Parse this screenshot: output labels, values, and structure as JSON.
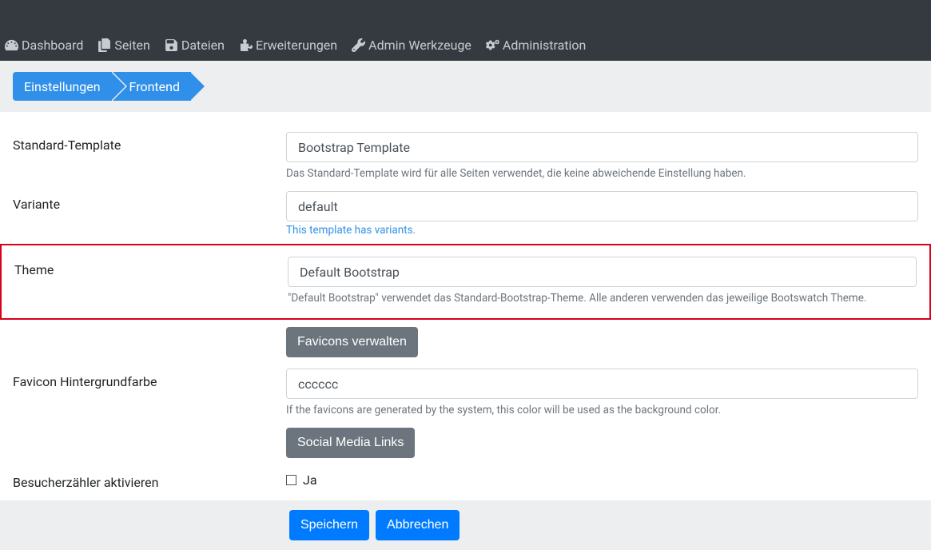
{
  "nav": {
    "dashboard": "Dashboard",
    "seiten": "Seiten",
    "dateien": "Dateien",
    "erweiterungen": "Erweiterungen",
    "admin_tools": "Admin Werkzeuge",
    "administration": "Administration"
  },
  "breadcrumb": {
    "a": "Einstellungen",
    "b": "Frontend"
  },
  "form": {
    "standard_template": {
      "label": "Standard-Template",
      "value": "Bootstrap Template",
      "help": "Das Standard-Template wird für alle Seiten verwendet, die keine abweichende Einstellung haben."
    },
    "variante": {
      "label": "Variante",
      "value": "default",
      "help": "This template has variants."
    },
    "theme": {
      "label": "Theme",
      "value": "Default Bootstrap",
      "help": "\"Default Bootstrap\" verwendet das Standard-Bootstrap-Theme. Alle anderen verwenden das jeweilige Bootswatch Theme."
    },
    "favicons_button": "Favicons verwalten",
    "favicon_bg": {
      "label": "Favicon Hintergrundfarbe",
      "value": "cccccc",
      "help": "If the favicons are generated by the system, this color will be used as the background color."
    },
    "social_button": "Social Media Links",
    "visitor_counter": {
      "label": "Besucherzähler aktivieren",
      "option": "Ja"
    }
  },
  "actions": {
    "save": "Speichern",
    "cancel": "Abbrechen"
  }
}
